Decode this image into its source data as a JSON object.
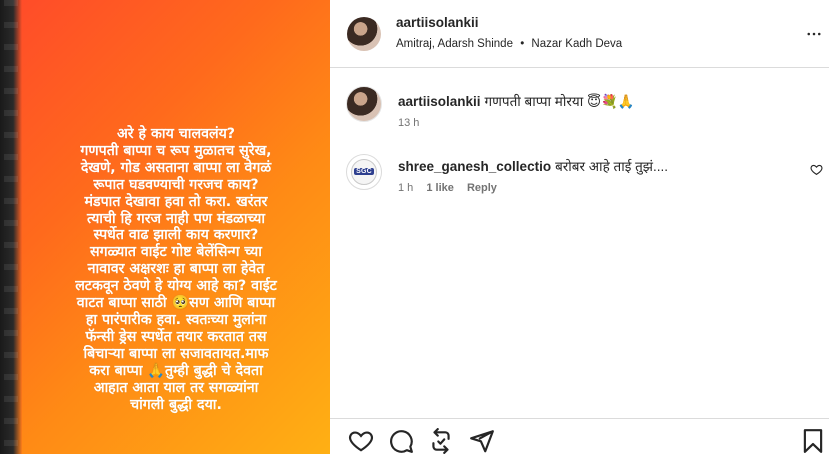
{
  "post": {
    "image_text": "अरे हे काय चालवलंय?\nगणपती बाप्पा च रूप मुळातच सुरेख,\nदेखणे, गोड असताना बाप्पा ला वेगळं\nरूपात घडवण्याची गरजच काय?\nमंडपात देखावा हवा तो करा. खरंतर\nत्याची हि गरज नाही पण मंडळाच्या\nस्पर्धेत वाढ झाली काय करणार?\nसगळ्यात वाईट गोष्ट बेलेंसिन्ग च्या\nनावावर अक्षरशः हा बाप्पा ला हेवेत\nलटकवून ठेवणे हे योग्य आहे का? वाईट\nवाटत बाप्पा साठी 🥺सण आणि बाप्पा\nहा पारंपारीक हवा. स्वतःच्या मुलांना\nफॅन्सी ड्रेस स्पर्धेत तयार करतात तस\nबिचाऱ्या बाप्पा ला सजावतायत.माफ\nकरा बाप्पा 🙏तुम्ही बुद्धी चे देवता\nआहात आता याल तर सगळ्यांना\nचांगली बुद्धी दया."
  },
  "header": {
    "username": "aartiisolankii",
    "audio_artist": "Amitraj, Adarsh Shinde",
    "separator": "•",
    "audio_track": "Nazar Kadh Deva",
    "more_icon": "more-horizontal-icon"
  },
  "caption": {
    "username": "aartiisolankii",
    "text": "गणपती बाप्पा मोरया 😇💐🙏",
    "time": "13 h"
  },
  "comments": [
    {
      "username": "shree_ganesh_collectio",
      "text": "बरोबर आहे ताई तुझं....",
      "time": "1 h",
      "likes": "1 like",
      "reply_label": "Reply",
      "avatar_text": "SGC"
    }
  ],
  "actions": {
    "like_icon": "heart-icon",
    "comment_icon": "comment-icon",
    "repost_icon": "repost-icon",
    "share_icon": "share-icon",
    "save_icon": "bookmark-icon"
  },
  "colors": {
    "media_gradient_start": "#ff4a2a",
    "media_gradient_end": "#ffb014",
    "text_primary": "#262626",
    "text_secondary": "#737373",
    "divider": "#dbdbdb"
  }
}
